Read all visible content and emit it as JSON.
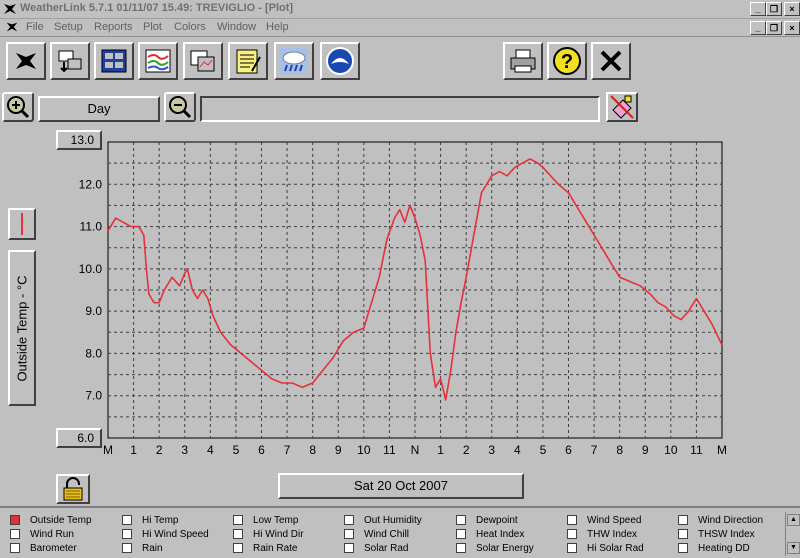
{
  "window": {
    "title": "WeatherLink 5.7.1  01/11/07  15.49: TREVIGLIO - [Plot]"
  },
  "menu": {
    "items": [
      "File",
      "Setup",
      "Reports",
      "Plot",
      "Colors",
      "Window",
      "Help"
    ]
  },
  "toolbar": {
    "buttons": [
      "station-icon",
      "download-icon",
      "bulletin-icon",
      "strip-chart-icon",
      "summary-icon",
      "notes-icon",
      "weather-icon",
      "noaa-icon",
      "print-icon",
      "help-icon",
      "close-icon"
    ]
  },
  "controls": {
    "range_label": "Day",
    "range_text": ""
  },
  "plot": {
    "ylabel": "Outside Temp - °C",
    "y_top_box": "13.0",
    "y_bottom_box": "6.0",
    "date_label": "Sat 20 Oct 2007"
  },
  "chart_data": {
    "type": "line",
    "title": "",
    "xlabel": "",
    "ylabel": "Outside Temp - °C",
    "ylim": [
      6.0,
      13.0
    ],
    "grid": true,
    "x_tick_labels": [
      "M",
      "1",
      "2",
      "3",
      "4",
      "5",
      "6",
      "7",
      "8",
      "9",
      "10",
      "11",
      "N",
      "1",
      "2",
      "3",
      "4",
      "5",
      "6",
      "7",
      "8",
      "9",
      "10",
      "11",
      "M"
    ],
    "y_tick_labels": [
      "12.0",
      "11.0",
      "10.0",
      "9.0",
      "8.0",
      "7.0"
    ],
    "series": [
      {
        "name": "Outside Temp",
        "color": "#e8303c",
        "x_hours": [
          0,
          0.3,
          0.6,
          0.9,
          1.2,
          1.4,
          1.5,
          1.6,
          1.8,
          2.0,
          2.2,
          2.5,
          2.8,
          3.0,
          3.1,
          3.3,
          3.5,
          3.7,
          3.9,
          4.1,
          4.4,
          4.8,
          5.2,
          5.6,
          6.0,
          6.4,
          6.8,
          7.2,
          7.6,
          8.0,
          8.4,
          8.8,
          9.2,
          9.6,
          10.0,
          10.3,
          10.6,
          10.9,
          11.2,
          11.4,
          11.6,
          11.8,
          12.0,
          12.2,
          12.4,
          12.6,
          12.8,
          13.0,
          13.2,
          13.4,
          13.6,
          13.8,
          14.0,
          14.3,
          14.6,
          15.0,
          15.3,
          15.6,
          15.9,
          16.2,
          16.5,
          16.8,
          17.0,
          17.3,
          17.6,
          18.0,
          18.4,
          18.8,
          19.2,
          19.6,
          20.0,
          20.4,
          20.8,
          21.2,
          21.5,
          21.8,
          22.1,
          22.4,
          22.7,
          23.0,
          23.3,
          23.6,
          24.0
        ],
        "values": [
          10.9,
          11.2,
          11.1,
          11.0,
          11.0,
          10.8,
          10.0,
          9.4,
          9.2,
          9.2,
          9.5,
          9.8,
          9.6,
          9.9,
          10.0,
          9.5,
          9.3,
          9.5,
          9.3,
          8.9,
          8.5,
          8.2,
          8.0,
          7.8,
          7.6,
          7.4,
          7.3,
          7.3,
          7.2,
          7.3,
          7.6,
          7.9,
          8.3,
          8.5,
          8.6,
          9.2,
          9.8,
          10.7,
          11.2,
          11.4,
          11.1,
          11.5,
          11.2,
          10.8,
          10.2,
          8.0,
          7.2,
          7.4,
          6.9,
          7.6,
          8.5,
          9.2,
          9.8,
          10.8,
          11.8,
          12.2,
          12.3,
          12.2,
          12.4,
          12.5,
          12.6,
          12.5,
          12.4,
          12.2,
          12.0,
          11.8,
          11.4,
          11.0,
          10.6,
          10.2,
          9.8,
          9.7,
          9.6,
          9.4,
          9.2,
          9.1,
          8.9,
          8.8,
          9.0,
          9.3,
          9.0,
          8.7,
          8.2
        ]
      }
    ]
  },
  "legend": {
    "items": [
      {
        "label": "Outside Temp",
        "checked": true
      },
      {
        "label": "Hi Temp",
        "checked": false
      },
      {
        "label": "Low Temp",
        "checked": false
      },
      {
        "label": "Out Humidity",
        "checked": false
      },
      {
        "label": "Dewpoint",
        "checked": false
      },
      {
        "label": "Wind Speed",
        "checked": false
      },
      {
        "label": "Wind Direction",
        "checked": false
      },
      {
        "label": "Wind Run",
        "checked": false
      },
      {
        "label": "Hi Wind Speed",
        "checked": false
      },
      {
        "label": "Hi Wind Dir",
        "checked": false
      },
      {
        "label": "Wind Chill",
        "checked": false
      },
      {
        "label": "Heat Index",
        "checked": false
      },
      {
        "label": "THW Index",
        "checked": false
      },
      {
        "label": "THSW Index",
        "checked": false
      },
      {
        "label": "Barometer",
        "checked": false
      },
      {
        "label": "Rain",
        "checked": false
      },
      {
        "label": "Rain Rate",
        "checked": false
      },
      {
        "label": "Solar Rad",
        "checked": false
      },
      {
        "label": "Solar Energy",
        "checked": false
      },
      {
        "label": "Hi Solar Rad",
        "checked": false
      },
      {
        "label": "Heating DD",
        "checked": false
      }
    ]
  }
}
